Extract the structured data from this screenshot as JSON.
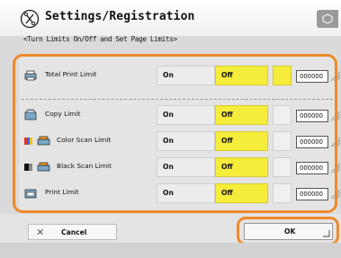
{
  "header": {
    "title": "Settings/Registration",
    "subtitle": "<Turn Limits On/Off and Set Page Limits>"
  },
  "rows": [
    {
      "label": "Total Print Limit",
      "on_label": "On",
      "off_label": "Off",
      "value": "000000",
      "icon": "printer-total-icon"
    },
    {
      "label": "Copy Limit",
      "on_label": "On",
      "off_label": "Off",
      "value": "000000",
      "icon": "copier-icon"
    },
    {
      "label": "Color Scan Limit",
      "on_label": "On",
      "off_label": "Off",
      "value": "000000",
      "icon": "color-scan-icon"
    },
    {
      "label": "Black Scan Limit",
      "on_label": "On",
      "off_label": "Off",
      "value": "000000",
      "icon": "black-scan-icon"
    },
    {
      "label": "Print Limit",
      "on_label": "On",
      "off_label": "Off",
      "value": "000000",
      "icon": "print-icon"
    }
  ],
  "buttons": {
    "cancel": "Cancel",
    "ok": "OK"
  },
  "colors": {
    "highlight": "#ef8a2a",
    "selected": "#f6ec3c"
  }
}
